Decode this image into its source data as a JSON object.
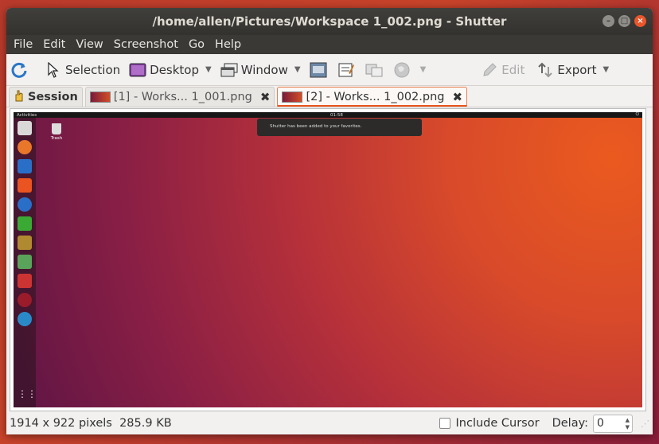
{
  "window": {
    "title": "/home/allen/Pictures/Workspace 1_002.png - Shutter"
  },
  "menu": [
    "File",
    "Edit",
    "View",
    "Screenshot",
    "Go",
    "Help"
  ],
  "toolbar": {
    "selection": "Selection",
    "desktop": "Desktop",
    "window": "Window",
    "edit": "Edit",
    "export": "Export"
  },
  "tabs": [
    {
      "label": "Session"
    },
    {
      "label": "[1] - Works... 1_001.png"
    },
    {
      "label": "[2] - Works... 1_002.png"
    }
  ],
  "screenshot": {
    "activities": "Activities",
    "clock": "01:58",
    "notification": "Shutter has been added to your favorites.",
    "trash": "Trash"
  },
  "status": {
    "info": "1914 x 922 pixels  285.9 KB",
    "include_cursor": "Include Cursor",
    "delay_label": "Delay:",
    "delay_value": "0"
  }
}
